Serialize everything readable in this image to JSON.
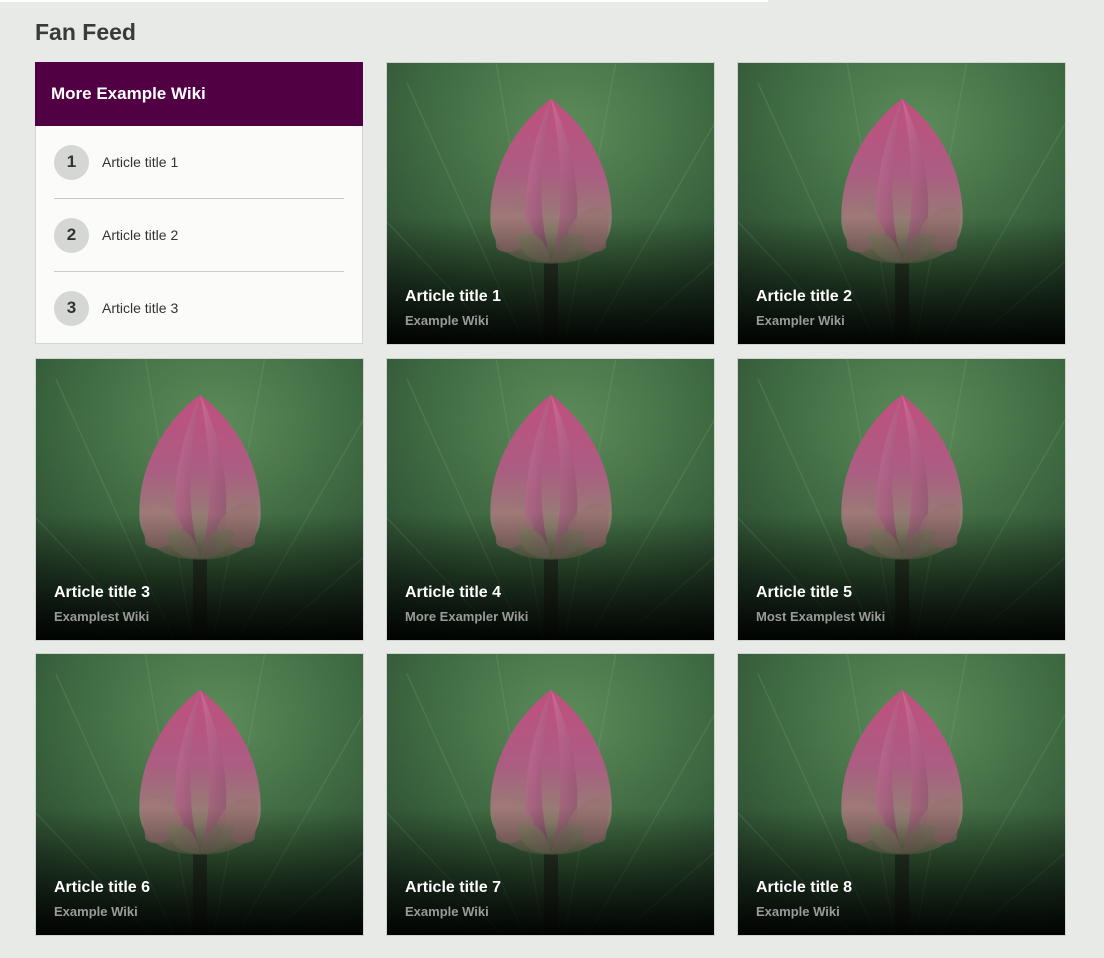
{
  "page": {
    "title": "Fan Feed"
  },
  "panel": {
    "title": "More Example Wiki",
    "items": [
      {
        "rank": "1",
        "title": "Article title 1"
      },
      {
        "rank": "2",
        "title": "Article title 2"
      },
      {
        "rank": "3",
        "title": "Article title 3"
      }
    ]
  },
  "cards": [
    {
      "title": "Article title 1",
      "wiki": "Example Wiki"
    },
    {
      "title": "Article title 2",
      "wiki": "Exampler Wiki"
    },
    {
      "title": "Article title 3",
      "wiki": "Examplest Wiki"
    },
    {
      "title": "Article title 4",
      "wiki": "More Exampler Wiki"
    },
    {
      "title": "Article title 5",
      "wiki": "Most Examplest Wiki"
    },
    {
      "title": "Article title 6",
      "wiki": "Example Wiki"
    },
    {
      "title": "Article title 7",
      "wiki": "Example Wiki"
    },
    {
      "title": "Article title 8",
      "wiki": "Example Wiki"
    }
  ],
  "colors": {
    "panel_header": "#520044",
    "page_bg": "#e8eae7"
  }
}
